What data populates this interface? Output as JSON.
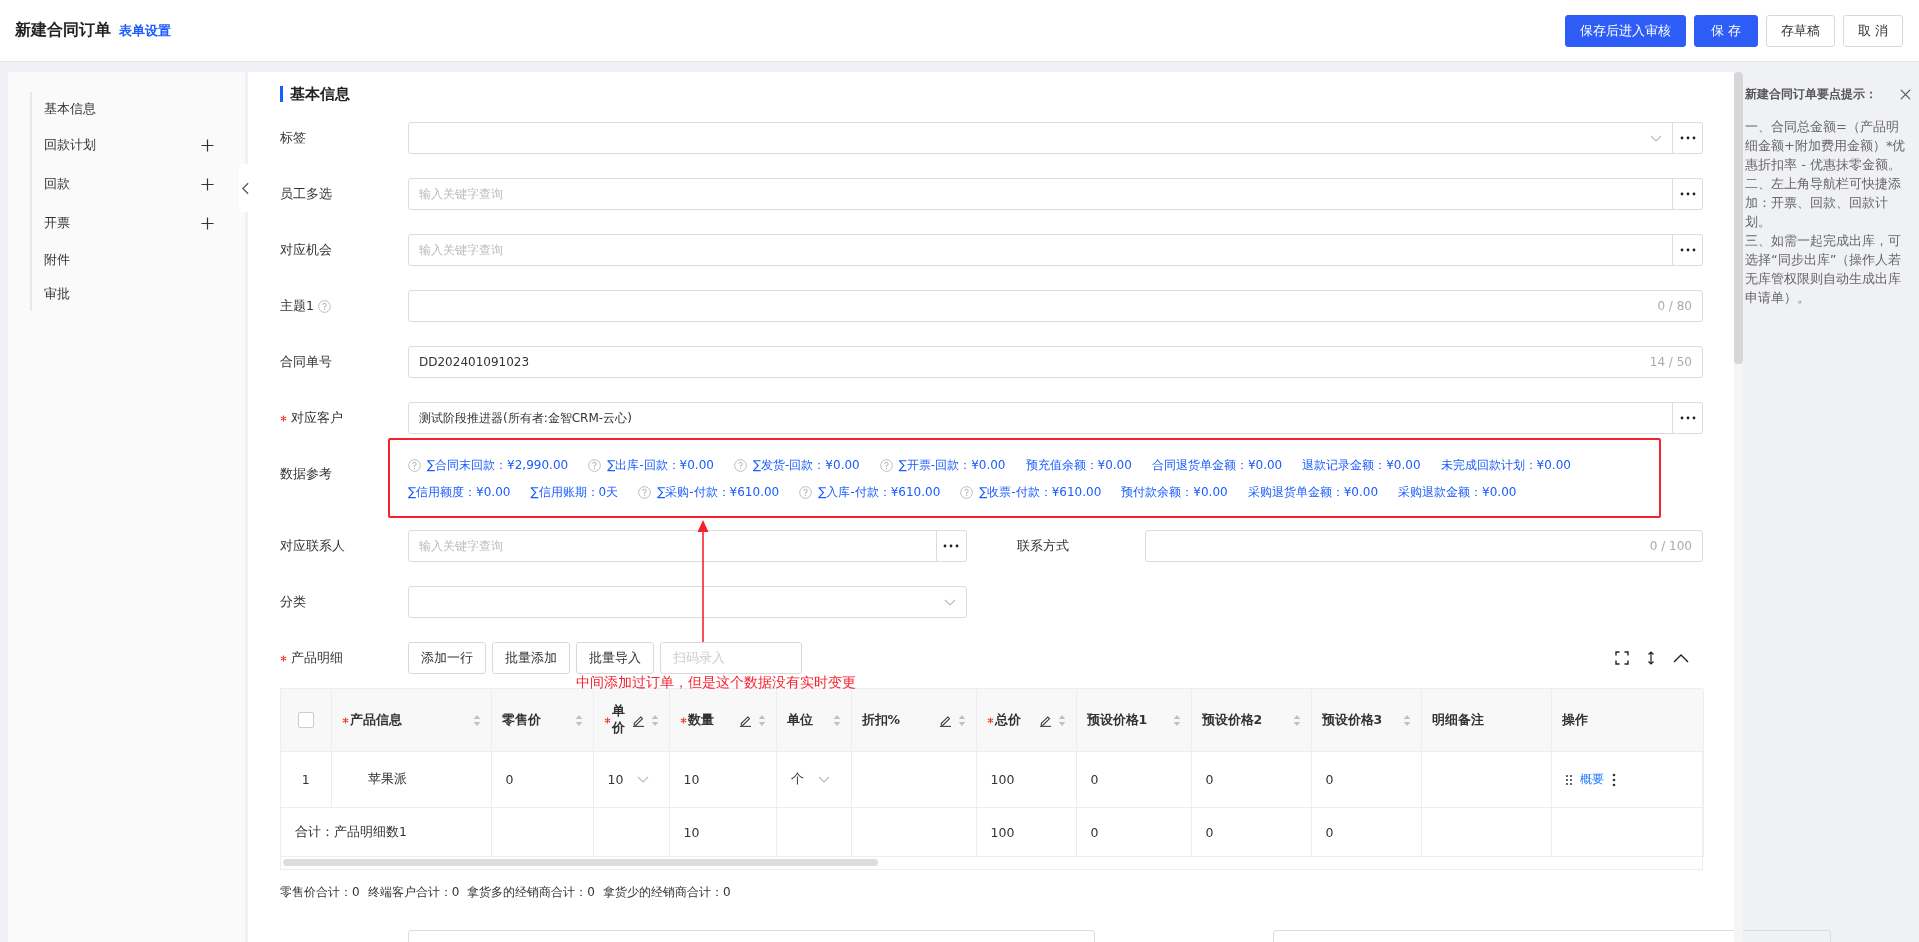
{
  "header": {
    "title": "新建合同订单",
    "settings_link": "表单设置",
    "buttons": [
      {
        "label": "保存后进入审核",
        "kind": "primary"
      },
      {
        "label": "保 存",
        "kind": "primary"
      },
      {
        "label": "存草稿",
        "kind": "default"
      },
      {
        "label": "取 消",
        "kind": "default"
      }
    ]
  },
  "nav": {
    "items": [
      {
        "label": "基本信息",
        "addable": false
      },
      {
        "label": "回款计划",
        "addable": true
      },
      {
        "label": "回款",
        "addable": true
      },
      {
        "label": "开票",
        "addable": true
      },
      {
        "label": "附件",
        "addable": false
      },
      {
        "label": "审批",
        "addable": false
      }
    ]
  },
  "section_title": "基本信息",
  "fields": [
    {
      "kind": "select",
      "label": "标签",
      "required": false,
      "more": true
    },
    {
      "kind": "lookup",
      "label": "员工多选",
      "required": false,
      "placeholder": "输入关键字查询"
    },
    {
      "kind": "lookup",
      "label": "对应机会",
      "required": false,
      "placeholder": "输入关键字查询"
    },
    {
      "kind": "text",
      "label": "主题1",
      "required": false,
      "help": true,
      "counter": "0 / 80"
    },
    {
      "kind": "text",
      "label": "合同单号",
      "required": false,
      "help": false,
      "value": "DD202401091023",
      "counter": "14 / 50"
    },
    {
      "kind": "lookup",
      "label": "对应客户",
      "required": true,
      "value": "测试阶段推进器(所有者:金智CRM-云心)"
    },
    {
      "kind": "reference",
      "label": "数据参考",
      "lines": [
        [
          {
            "text": "∑合同末回款：¥2,990.00",
            "help": true
          },
          {
            "text": "∑出库-回款：¥0.00",
            "help": true
          },
          {
            "text": "∑发货-回款：¥0.00",
            "help": true
          },
          {
            "text": "∑开票-回款：¥0.00",
            "help": true
          },
          {
            "text": "预充值余额：¥0.00",
            "help": false
          },
          {
            "text": "合同退货单金额：¥0.00",
            "help": false
          },
          {
            "text": "退款记录金额：¥0.00",
            "help": false
          },
          {
            "text": "未完成回款计划：¥0.00",
            "help": false
          }
        ],
        [
          {
            "text": "∑信用额度：¥0.00",
            "help": false
          },
          {
            "text": "∑信用账期：0天",
            "help": false
          },
          {
            "text": "∑采购-付款：¥610.00",
            "help": true
          },
          {
            "text": "∑入库-付款：¥610.00",
            "help": true
          },
          {
            "text": "∑收票-付款：¥610.00",
            "help": true
          },
          {
            "text": "预付款余额：¥0.00",
            "help": false
          },
          {
            "text": "采购退货单金额：¥0.00",
            "help": false
          },
          {
            "text": "采购退款金额：¥0.00",
            "help": false
          }
        ]
      ]
    },
    {
      "kind": "pair",
      "fields": [
        {
          "kind": "lookup",
          "label": "对应联系人",
          "required": false,
          "placeholder": "输入关键字查询"
        },
        {
          "kind": "text",
          "label": "联系方式",
          "required": false,
          "help": false,
          "counter": "0 / 100"
        }
      ]
    },
    {
      "kind": "pair",
      "fields": [
        {
          "kind": "select",
          "label": "分类",
          "required": false,
          "more": false
        }
      ]
    }
  ],
  "products": {
    "label": "产品明细",
    "required": true,
    "buttons": [
      {
        "label": "添加一行",
        "disabled": false
      },
      {
        "label": "批量添加",
        "disabled": false
      },
      {
        "label": "批量导入",
        "disabled": false
      },
      {
        "label": "扫码录入",
        "disabled": true
      }
    ],
    "select_all": {
      "checked": false
    },
    "columns": [
      {
        "label": "产品信息",
        "required": true,
        "editable": false,
        "sortable": true
      },
      {
        "label": "零售价",
        "required": false,
        "editable": false,
        "sortable": true
      },
      {
        "label": "单价",
        "required": true,
        "editable": true,
        "sortable": true
      },
      {
        "label": "数量",
        "required": true,
        "editable": true,
        "sortable": true
      },
      {
        "label": "单位",
        "required": false,
        "editable": false,
        "sortable": true
      },
      {
        "label": "折扣%",
        "required": false,
        "editable": true,
        "sortable": true
      },
      {
        "label": "总价",
        "required": true,
        "editable": true,
        "sortable": true
      },
      {
        "label": "预设价格1",
        "required": false,
        "editable": false,
        "sortable": true
      },
      {
        "label": "预设价格2",
        "required": false,
        "editable": false,
        "sortable": true
      },
      {
        "label": "预设价格3",
        "required": false,
        "editable": false,
        "sortable": true
      },
      {
        "label": "明细备注",
        "required": false,
        "editable": false,
        "sortable": false
      },
      {
        "label": "操作",
        "required": false,
        "editable": false,
        "sortable": false
      }
    ],
    "rows": [
      {
        "index": "1",
        "cells": [
          {
            "kind": "text",
            "text": "苹果派"
          },
          {
            "kind": "text",
            "text": "0"
          },
          {
            "kind": "select",
            "text": "10"
          },
          {
            "kind": "text",
            "text": "10"
          },
          {
            "kind": "select",
            "text": "个"
          },
          {
            "kind": "empty"
          },
          {
            "kind": "text",
            "text": "100"
          },
          {
            "kind": "text",
            "text": "0"
          },
          {
            "kind": "text",
            "text": "0"
          },
          {
            "kind": "text",
            "text": "0"
          },
          {
            "kind": "empty"
          },
          {
            "kind": "actions",
            "link": "概要"
          }
        ]
      }
    ],
    "total": {
      "label": "合计：产品明细数1",
      "cells": [
        {
          "kind": "empty"
        },
        {
          "kind": "empty"
        },
        {
          "kind": "text",
          "text": "10"
        },
        {
          "kind": "empty"
        },
        {
          "kind": "empty"
        },
        {
          "kind": "text",
          "text": "100"
        },
        {
          "kind": "text",
          "text": "0"
        },
        {
          "kind": "text",
          "text": "0"
        },
        {
          "kind": "text",
          "text": "0"
        },
        {
          "kind": "empty"
        },
        {
          "kind": "empty"
        }
      ]
    },
    "summary": [
      "零售价合计：0",
      "终端客户合计：0",
      "拿货多的经销商合计：0",
      "拿货少的经销商合计：0"
    ]
  },
  "annotation": {
    "text": "中间添加过订单，但是这个数据没有实时变更"
  },
  "tips": {
    "title": "新建合同订单要点提示：",
    "paragraphs": [
      "一、合同总金额=（产品明细金额+附加费用金额）*优惠折扣率 - 优惠抹零金额。",
      "二、左上角导航栏可快捷添加：开票、回款、回款计划。",
      "三、如需一起完成出库，可选择“同步出库”（操作人若无库管权限则自动生成出库申请单）。"
    ]
  }
}
